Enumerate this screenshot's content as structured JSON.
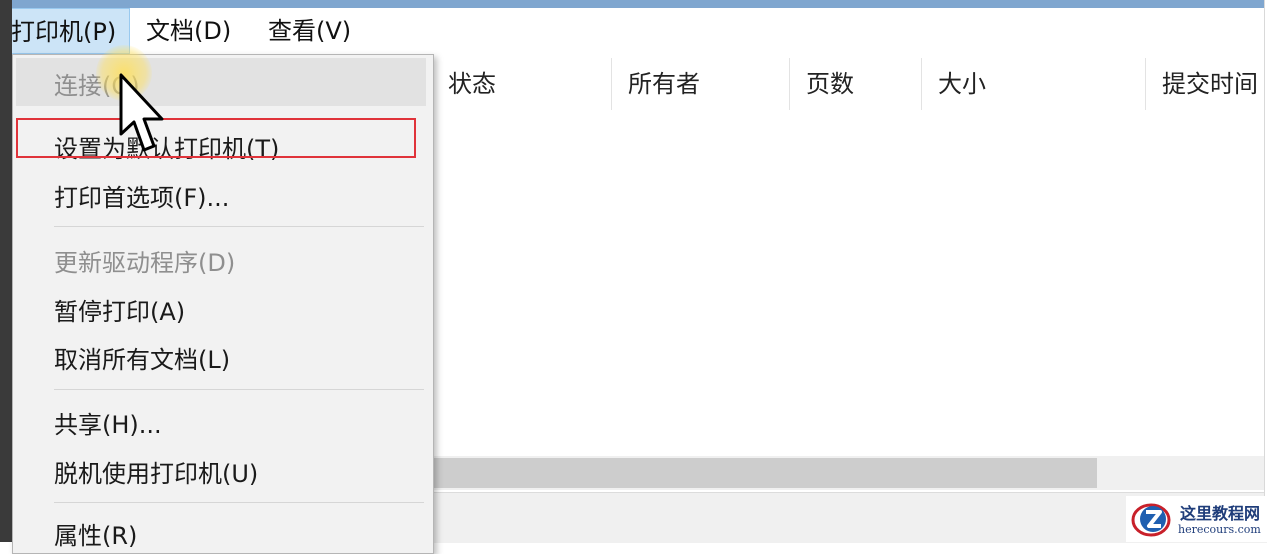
{
  "menubar": {
    "printer": "打印机(P)",
    "document": "文档(D)",
    "view": "查看(V)"
  },
  "columns": [
    "状态",
    "所有者",
    "页数",
    "大小",
    "提交时间"
  ],
  "printer_menu": {
    "connect": "连接(O)",
    "set_default": "设置为默认打印机(T)",
    "preferences": "打印首选项(F)...",
    "update_driver": "更新驱动程序(D)",
    "pause": "暂停打印(A)",
    "cancel_all": "取消所有文档(L)",
    "share": "共享(H)...",
    "offline": "脱机使用打印机(U)",
    "properties": "属性(R)"
  },
  "watermark": {
    "title": "这里教程网",
    "url": "herecours.com"
  },
  "colors": {
    "highlight_box": "#e0333a",
    "menu_active": "#cce4f7",
    "title_strip": "#7fa6cf"
  }
}
